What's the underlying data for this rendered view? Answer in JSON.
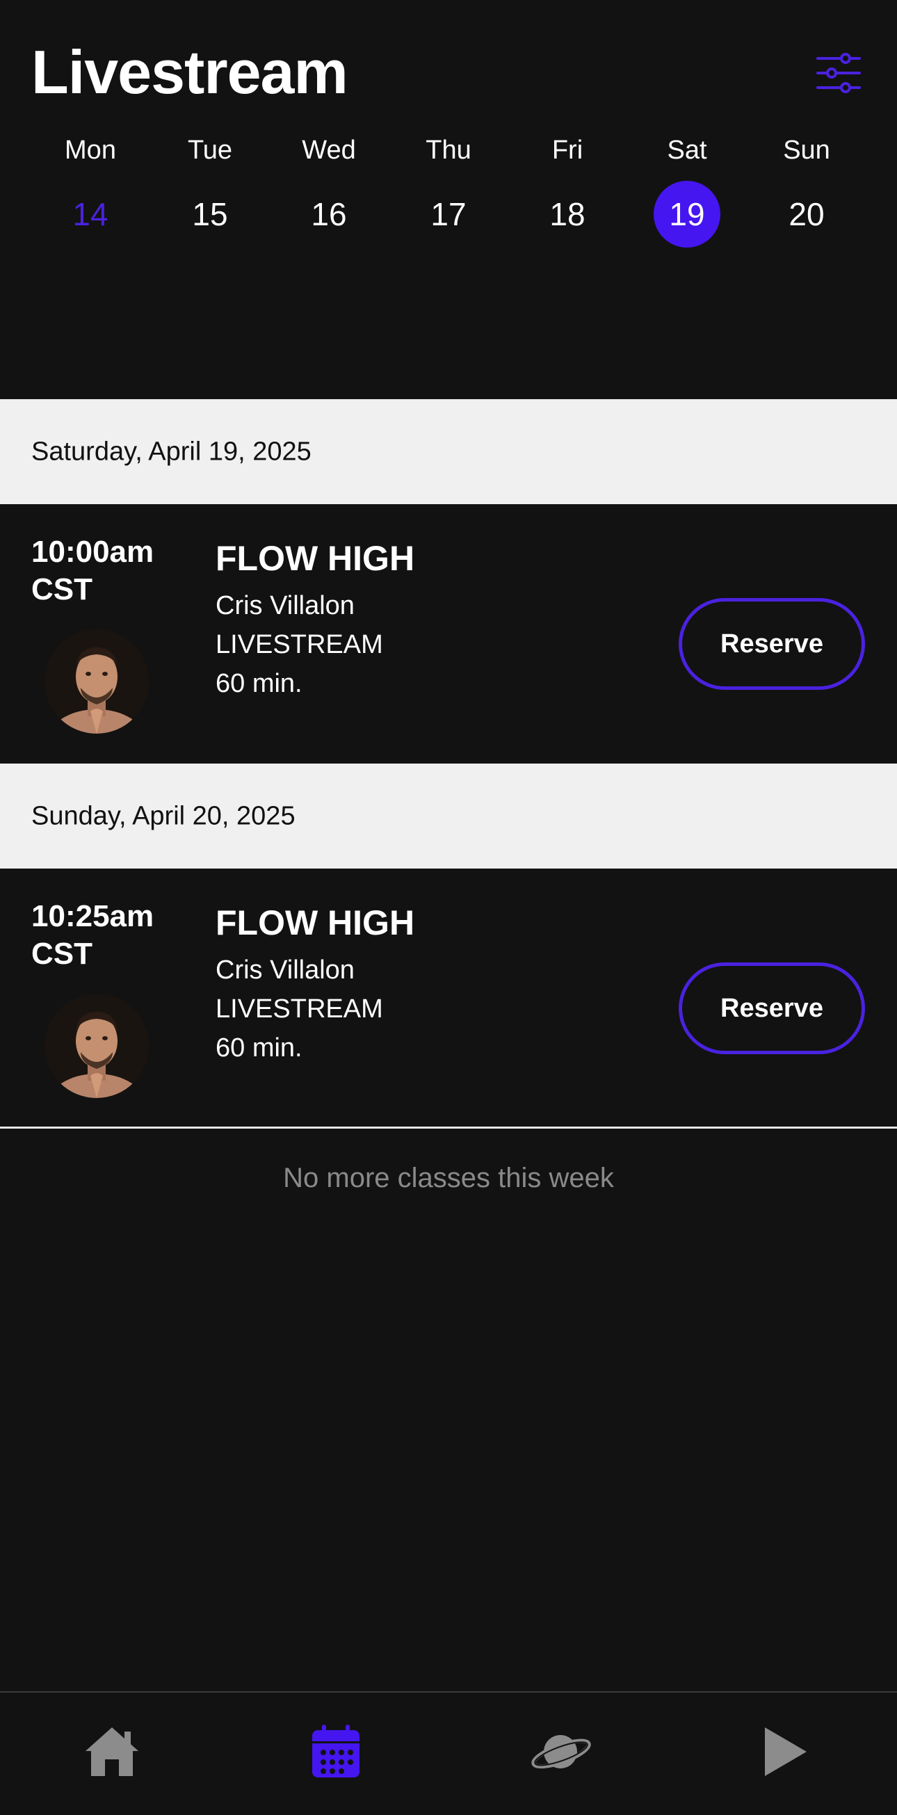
{
  "header": {
    "title": "Livestream"
  },
  "week": [
    {
      "name": "Mon",
      "num": "14"
    },
    {
      "name": "Tue",
      "num": "15"
    },
    {
      "name": "Wed",
      "num": "16"
    },
    {
      "name": "Thu",
      "num": "17"
    },
    {
      "name": "Fri",
      "num": "18"
    },
    {
      "name": "Sat",
      "num": "19"
    },
    {
      "name": "Sun",
      "num": "20"
    }
  ],
  "sections": [
    {
      "date": "Saturday, April 19, 2025",
      "class": {
        "time": "10:00am",
        "tz": "CST",
        "name": "FLOW HIGH",
        "instructor": "Cris Villalon",
        "type": "LIVESTREAM",
        "duration": "60 min.",
        "button": "Reserve"
      }
    },
    {
      "date": "Sunday, April 20, 2025",
      "class": {
        "time": "10:25am",
        "tz": "CST",
        "name": "FLOW HIGH",
        "instructor": "Cris Villalon",
        "type": "LIVESTREAM",
        "duration": "60 min.",
        "button": "Reserve"
      }
    }
  ],
  "empty_message": "No more classes this week",
  "colors": {
    "accent": "#4516f0",
    "background": "#121212",
    "section_bg": "#f0f0f0",
    "muted": "#8a8a8a"
  },
  "tabs": [
    {
      "icon": "home-icon",
      "active": false
    },
    {
      "icon": "calendar-icon",
      "active": true
    },
    {
      "icon": "planet-icon",
      "active": false
    },
    {
      "icon": "play-icon",
      "active": false
    }
  ]
}
